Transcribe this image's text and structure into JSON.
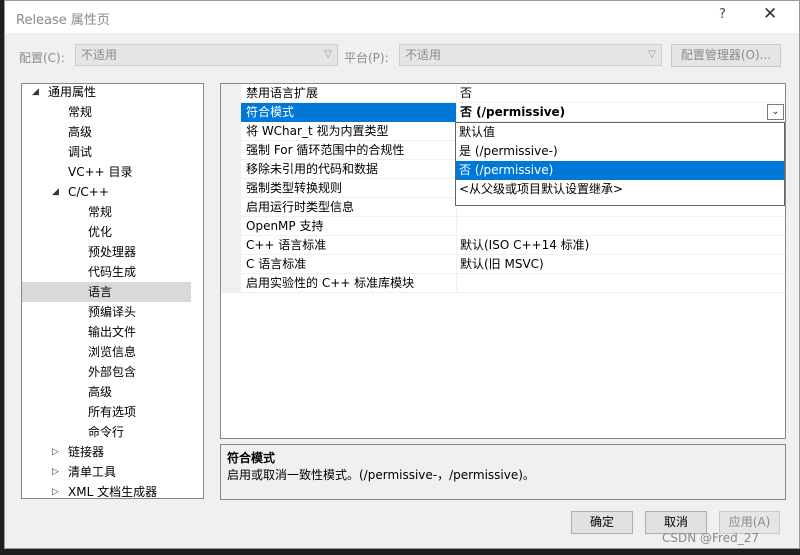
{
  "window": {
    "title": "Release 属性页"
  },
  "header": {
    "config_label": "配置(C):",
    "config_value": "不适用",
    "platform_label": "平台(P):",
    "platform_value": "不适用",
    "config_manager_label": "配置管理器(O)..."
  },
  "tree": {
    "items": [
      {
        "label": "通用属性",
        "expander": "◢"
      },
      {
        "label": "常规"
      },
      {
        "label": "高级"
      },
      {
        "label": "调试"
      },
      {
        "label": "VC++ 目录"
      },
      {
        "label": "C/C++",
        "expander": "◢"
      },
      {
        "label": "常规"
      },
      {
        "label": "优化"
      },
      {
        "label": "预处理器"
      },
      {
        "label": "代码生成"
      },
      {
        "label": "语言",
        "selected": true
      },
      {
        "label": "预编译头"
      },
      {
        "label": "输出文件"
      },
      {
        "label": "浏览信息"
      },
      {
        "label": "外部包含"
      },
      {
        "label": "高级"
      },
      {
        "label": "所有选项"
      },
      {
        "label": "命令行"
      },
      {
        "label": "链接器",
        "expander": "▷"
      },
      {
        "label": "清单工具",
        "expander": "▷"
      },
      {
        "label": "XML 文档生成器",
        "expander": "▷"
      }
    ]
  },
  "properties": [
    {
      "name": "禁用语言扩展",
      "value": "否"
    },
    {
      "name": "符合模式",
      "value": "否 (/permissive)",
      "selected": true
    },
    {
      "name": "将 WChar_t 视为内置类型",
      "value": ""
    },
    {
      "name": "强制 For 循环范围中的合规性",
      "value": ""
    },
    {
      "name": "移除未引用的代码和数据",
      "value": ""
    },
    {
      "name": "强制类型转换规则",
      "value": ""
    },
    {
      "name": "启用运行时类型信息",
      "value": ""
    },
    {
      "name": "OpenMP 支持",
      "value": ""
    },
    {
      "name": "C++ 语言标准",
      "value": "默认(ISO C++14 标准)"
    },
    {
      "name": "C 语言标准",
      "value": "默认(旧 MSVC)"
    },
    {
      "name": "启用实验性的 C++ 标准库模块",
      "value": ""
    }
  ],
  "dropdown": {
    "options": [
      {
        "label": "默认值"
      },
      {
        "label": "是 (/permissive-)"
      },
      {
        "label": "否 (/permissive)",
        "selected": true
      },
      {
        "label": "<从父级或项目默认设置继承>"
      }
    ]
  },
  "description": {
    "title": "符合模式",
    "text": "启用或取消一致性模式。(/permissive-，/permissive)。"
  },
  "footer": {
    "ok_label": "确定",
    "cancel_label": "取消",
    "apply_label": "应用(A)"
  },
  "watermark": "CSDN @Fred_27",
  "icons": {
    "close": "✕",
    "help": "?",
    "chevron_down": "⌄"
  },
  "colors": {
    "selection": "#0078d7",
    "tree_selection": "#d9d9d9"
  }
}
